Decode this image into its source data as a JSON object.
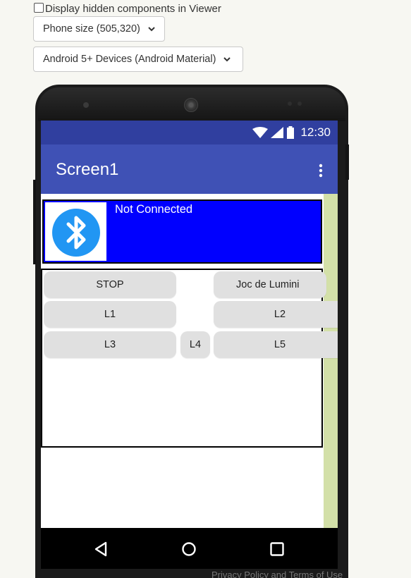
{
  "viewer_options": {
    "hidden_components_label": "Display hidden components in Viewer",
    "phone_size_selected": "Phone size (505,320)",
    "device_type_selected": "Android 5+ Devices (Android Material)"
  },
  "status_bar": {
    "time": "12:30",
    "icons": [
      "wifi-icon",
      "cellular-signal-icon",
      "battery-icon"
    ]
  },
  "app_bar": {
    "title": "Screen1",
    "menu_icon": "overflow-menu-icon"
  },
  "bluetooth_row": {
    "icon": "bluetooth-icon",
    "status_label": "Not Connected",
    "background_color": "#0000ff"
  },
  "buttons": {
    "stop": "STOP",
    "joc_de_lumini": "Joc de Lumini",
    "l1": "L1",
    "l2": "L2",
    "l3": "L3",
    "l4": "L4",
    "l5": "L5"
  },
  "nav_bar": {
    "icons": [
      "back-icon",
      "home-icon",
      "recents-icon"
    ]
  },
  "footer": {
    "text": "Privacy Policy and Terms of Use"
  },
  "colors": {
    "status_bar": "#303f9f",
    "app_bar": "#3f51b5",
    "scrollbar": "#d3e0a8",
    "button": "#e0e0e0"
  }
}
